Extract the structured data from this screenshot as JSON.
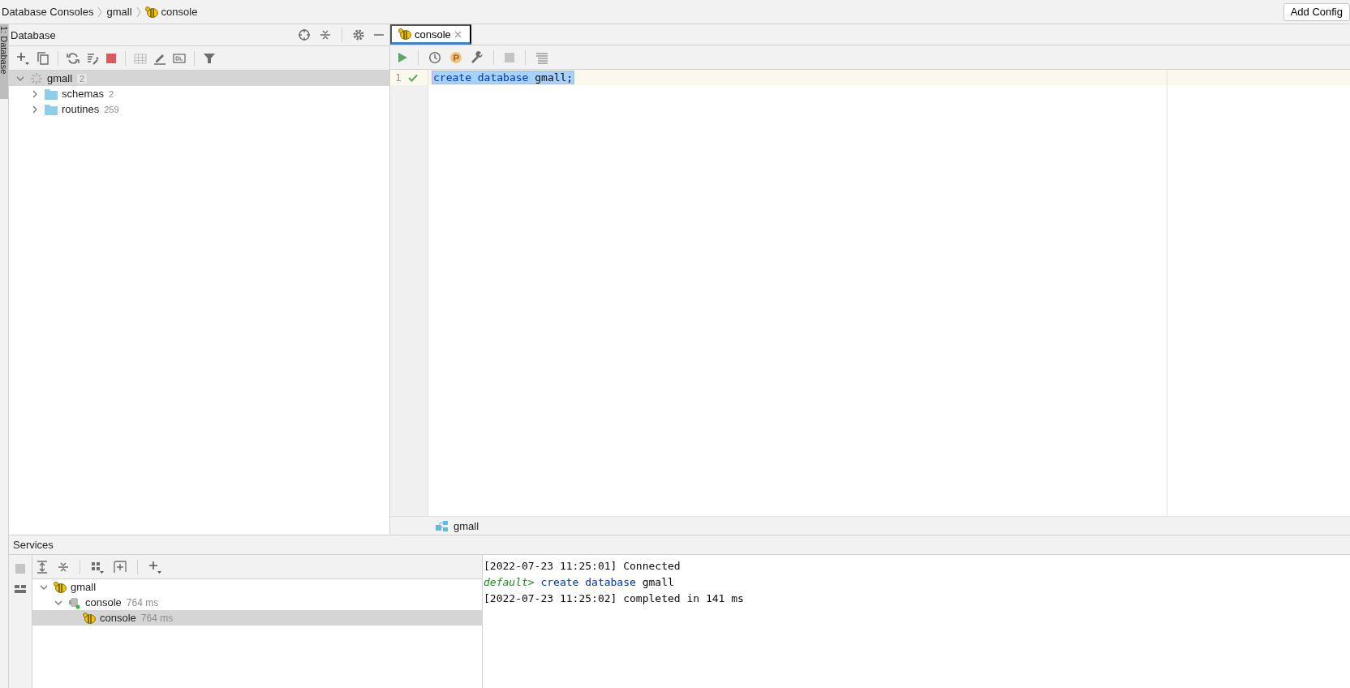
{
  "breadcrumb": [
    {
      "label": "Database Consoles",
      "kind": "plain"
    },
    {
      "label": "gmall",
      "kind": "plain"
    },
    {
      "label": "console",
      "kind": "console"
    }
  ],
  "run_config_button": {
    "label": "Add Config"
  },
  "side_strip": {
    "label": "1: Database"
  },
  "database_panel": {
    "title": "Database",
    "tree": [
      {
        "label": "gmall",
        "count": "2",
        "kind": "datasource",
        "expanded": true,
        "selected": true,
        "children": [
          {
            "label": "schemas",
            "count": "2",
            "kind": "folder",
            "expanded": false,
            "selected": false
          },
          {
            "label": "routines",
            "count": "259",
            "kind": "folder",
            "expanded": false,
            "selected": false
          }
        ]
      }
    ]
  },
  "editor": {
    "tabs": [
      {
        "label": "console",
        "selected": true
      }
    ],
    "lines": [
      {
        "number": "1",
        "executed": true,
        "selected": true,
        "tokens": [
          {
            "text": "create database",
            "kind": "keyword"
          },
          {
            "text": " gmall;",
            "kind": "plain"
          }
        ]
      }
    ],
    "footer": {
      "label": "gmall"
    }
  },
  "services": {
    "title": "Services",
    "tree": [
      {
        "label": "gmall",
        "kind": "datasource",
        "expanded": true,
        "selected": false,
        "children": [
          {
            "label": "console",
            "time": "764 ms",
            "kind": "session",
            "expanded": true,
            "selected": false,
            "children": [
              {
                "label": "console",
                "time": "764 ms",
                "kind": "console",
                "selected": true
              }
            ]
          }
        ]
      }
    ],
    "output": [
      {
        "tokens": [
          {
            "text": "[2022-07-23 11:25:01] Connected",
            "kind": "plain"
          }
        ]
      },
      {
        "tokens": [
          {
            "text": "default>",
            "kind": "prompt"
          },
          {
            "text": " create database",
            "kind": "keyword"
          },
          {
            "text": " gmall",
            "kind": "plain"
          }
        ]
      },
      {
        "tokens": [
          {
            "text": "[2022-07-23 11:25:02] completed in 141 ms",
            "kind": "plain"
          }
        ]
      }
    ]
  }
}
